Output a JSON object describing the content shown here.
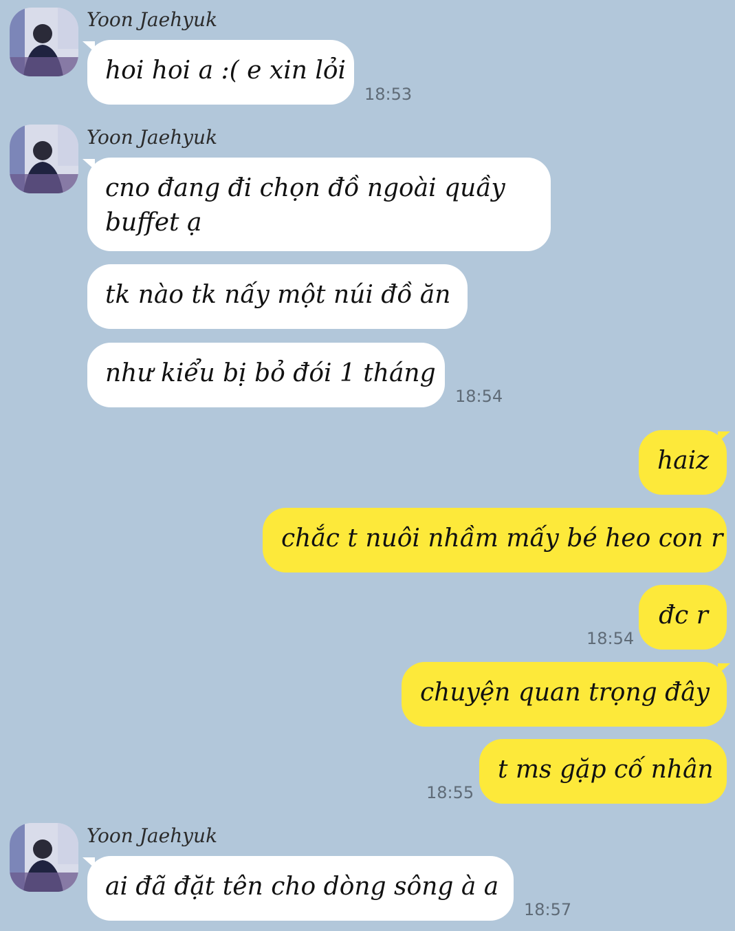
{
  "colors": {
    "background": "#b2c7da",
    "incoming_bubble": "#ffffff",
    "outgoing_bubble": "#fde93a",
    "timestamp": "#5f6b77"
  },
  "groups": [
    {
      "sender": "Yoon Jaehyuk",
      "avatar": "profile-photo",
      "messages": [
        "hoi hoi a :( e xin lỏi"
      ],
      "time": "18:53"
    },
    {
      "sender": "Yoon Jaehyuk",
      "avatar": "profile-photo",
      "messages": [
        "cno đang đi chọn đồ ngoài quầy buffet ạ",
        "tk nào tk nấy một núi đồ ăn",
        "như kiểu bị bỏ đói 1 tháng"
      ],
      "time": "18:54"
    },
    {
      "sender": "me",
      "messages": [
        "haiz",
        "chắc t nuôi nhầm mấy bé heo con r",
        "đc r"
      ],
      "time": "18:54"
    },
    {
      "sender": "me",
      "messages": [
        "chuyện quan trọng đây",
        "t ms gặp cố nhân"
      ],
      "time": "18:55"
    },
    {
      "sender": "Yoon Jaehyuk",
      "avatar": "profile-photo",
      "messages": [
        "ai đã đặt tên cho dòng sông à a"
      ],
      "time": "18:57"
    }
  ]
}
